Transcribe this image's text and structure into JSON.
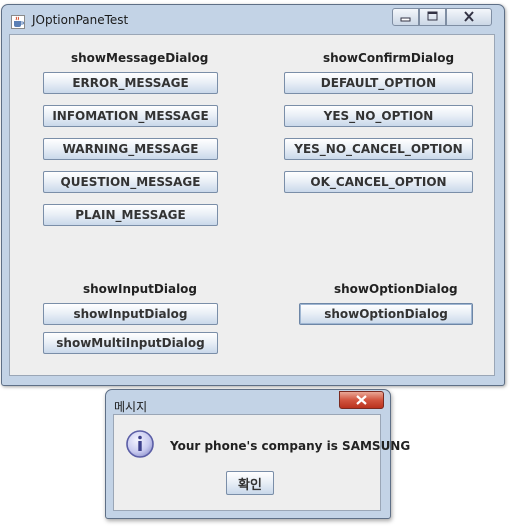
{
  "window": {
    "title": "JOptionPaneTest",
    "icon": "java-cup-icon",
    "controls": [
      "minimize-icon",
      "maximize-icon",
      "close-icon"
    ]
  },
  "message_section": {
    "label": "showMessageDialog",
    "buttons": [
      "ERROR_MESSAGE",
      "INFOMATION_MESSAGE",
      "WARNING_MESSAGE",
      "QUESTION_MESSAGE",
      "PLAIN_MESSAGE"
    ]
  },
  "confirm_section": {
    "label": "showConfirmDialog",
    "buttons": [
      "DEFAULT_OPTION",
      "YES_NO_OPTION",
      "YES_NO_CANCEL_OPTION",
      "OK_CANCEL_OPTION"
    ]
  },
  "input_section": {
    "label": "showInputDialog",
    "buttons": [
      "showInputDialog",
      "showMultiInputDialog"
    ]
  },
  "option_section": {
    "label": "showOptionDialog",
    "buttons": [
      "showOptionDialog"
    ]
  },
  "dialog": {
    "title": "메시지",
    "icon": "information-icon",
    "message": "Your phone's company is SAMSUNG",
    "ok_label": "확인"
  },
  "colors": {
    "window_frame": "#c3d3e6",
    "client_background": "#eeeeee",
    "dialog_close": "#c7432e",
    "info_icon": "#5b5ea6"
  }
}
